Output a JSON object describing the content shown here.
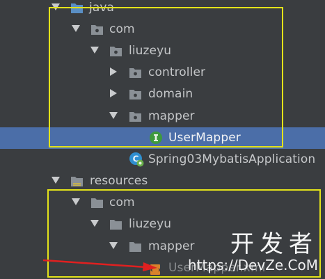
{
  "tree": {
    "java_label": "java",
    "com_label": "com",
    "liuzeyu_label": "liuzeyu",
    "controller_label": "controller",
    "domain_label": "domain",
    "mapper_label": "mapper",
    "usermapper_label": "UserMapper",
    "application_label": "Spring03MybatisApplication",
    "resources_label": "resources",
    "res_com_label": "com",
    "res_liuzeyu_label": "liuzeyu",
    "res_mapper_label": "mapper",
    "res_file_label": "UserMapper.xml"
  },
  "watermark": {
    "chinese": "开发者",
    "url": "https://DevZe.CoM"
  },
  "colors": {
    "background": "#3a3d40",
    "selection": "#4b6ea8",
    "annotation_box": "#e3e31a",
    "annotation_arrow": "#e02020",
    "interface_badge": "#3e9a3e",
    "folder": "#8a9096"
  },
  "icons": {
    "folder": "folder-icon",
    "package": "package-icon",
    "source_root": "source-folder-icon",
    "resources_root": "resources-folder-icon",
    "interface": "interface-icon",
    "spring_class": "spring-boot-class-icon",
    "xml": "xml-file-icon"
  }
}
